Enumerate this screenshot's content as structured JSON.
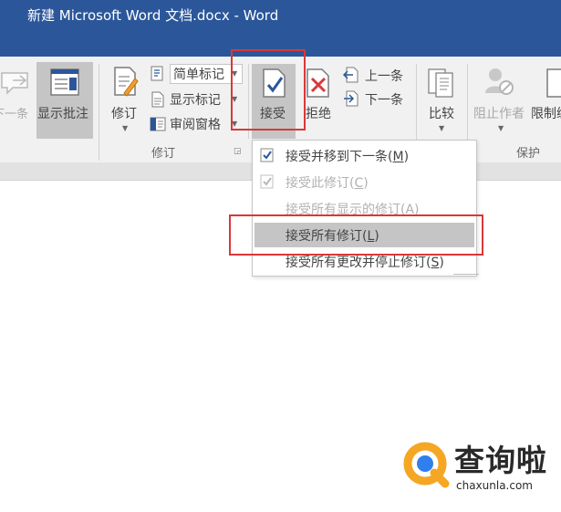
{
  "window": {
    "title": "新建 Microsoft Word 文档.docx - Word"
  },
  "ribbon": {
    "comments": {
      "next_label": "下一条",
      "show_comments_label": "显示批注"
    },
    "tracking": {
      "track_changes_label": "修订",
      "simple_markup_value": "简单标记",
      "show_markup_label": "显示标记",
      "reviewing_pane_label": "审阅窗格",
      "group_label": "修订"
    },
    "changes": {
      "accept_label": "接受",
      "reject_label": "拒绝",
      "previous_label": "上一条",
      "next_label": "下一条"
    },
    "compare": {
      "compare_label": "比较"
    },
    "protect": {
      "block_authors_label": "阻止作者",
      "restrict_editing_label": "限制编",
      "group_label": "保护"
    }
  },
  "accept_menu": {
    "items": [
      {
        "label": "接受并移到下一条(M)",
        "enabled": true,
        "icon": "check-icon"
      },
      {
        "label": "接受此修订(C)",
        "enabled": false,
        "icon": "check-icon"
      },
      {
        "label": "接受所有显示的修订(A)",
        "enabled": false,
        "icon": ""
      },
      {
        "label": "接受所有修订(L)",
        "enabled": true,
        "icon": "",
        "highlighted": true
      },
      {
        "label": "接受所有更改并停止修订(S)",
        "enabled": true,
        "icon": ""
      }
    ]
  },
  "watermark": {
    "brand": "查询啦",
    "url": "chaxunla.com"
  },
  "colors": {
    "title_bar": "#2b579a",
    "ribbon_bg": "#f1f1f1",
    "highlight_red": "#d9383a",
    "menu_hover": "#c5c5c5",
    "watermark_orange": "#f5a623",
    "watermark_blue": "#2f80ed"
  }
}
